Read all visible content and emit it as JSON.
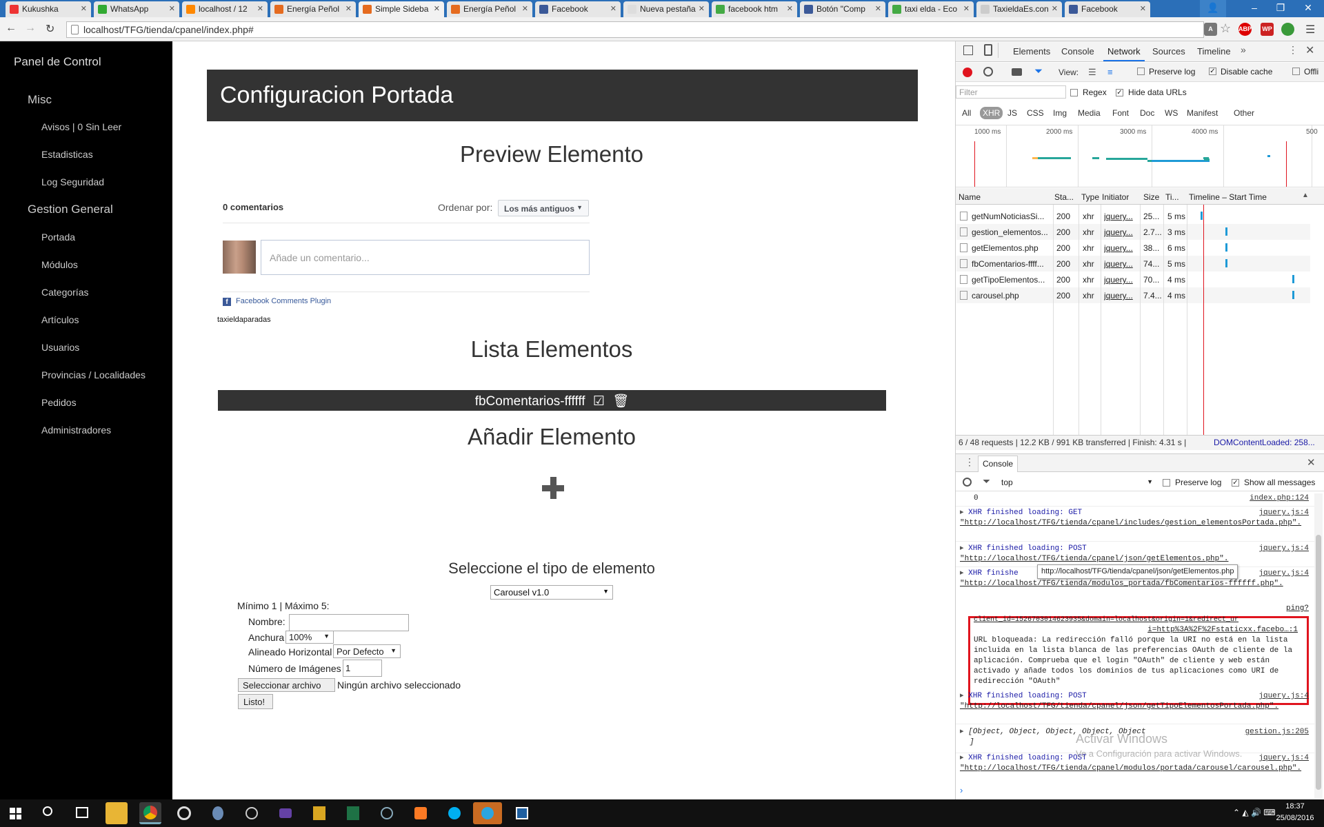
{
  "browser": {
    "tabs": [
      {
        "title": "Kukushka",
        "color": "#e33"
      },
      {
        "title": "WhatsApp",
        "color": "#3a3"
      },
      {
        "title": "localhost / 12",
        "color": "#f80"
      },
      {
        "title": "Energía Peñol",
        "color": "#e56b1f"
      },
      {
        "title": "Simple Sideba",
        "color": "#e56b1f"
      },
      {
        "title": "Energía Peñol",
        "color": "#e56b1f"
      },
      {
        "title": "Facebook",
        "color": "#3b5998"
      },
      {
        "title": "Nueva pestaña",
        "color": "#ddd"
      },
      {
        "title": "facebook htm",
        "color": "#4a4"
      },
      {
        "title": "Botón \"Comp",
        "color": "#3b5998"
      },
      {
        "title": "taxi elda - Eco",
        "color": "#4a4"
      },
      {
        "title": "TaxieldaEs.con",
        "color": "#ccc"
      },
      {
        "title": "Facebook",
        "color": "#3b5998"
      }
    ],
    "url": "localhost/TFG/tienda/cpanel/index.php#"
  },
  "sidebar": {
    "title": "Panel de Control",
    "sections": [
      {
        "label": "Misc",
        "items": [
          "Avisos | 0 Sin Leer",
          "Estadisticas",
          "Log Seguridad"
        ]
      },
      {
        "label": "Gestion General",
        "items": [
          "Portada",
          "Módulos",
          "Categorías",
          "Artículos",
          "Usuarios",
          "Provincias / Localidades",
          "Pedidos",
          "Administradores"
        ]
      }
    ]
  },
  "main": {
    "header": "Configuracion Portada",
    "preview_title": "Preview Elemento",
    "comments_count": "0 comentarios",
    "order_label": "Ordenar por:",
    "order_value": "Los más antiguos",
    "comment_placeholder": "Añade un comentario...",
    "plugin_label": "Facebook Comments Plugin",
    "page_name": "taxieldaparadas",
    "list_title": "Lista Elementos",
    "list_item": "fbComentarios-ffffff",
    "add_title": "Añadir Elemento",
    "select_type_title": "Seleccione el tipo de elemento",
    "type_value": "Carousel v1.0",
    "form": {
      "limits": "Mínimo 1 | Máximo 5:",
      "name_label": "Nombre:",
      "width_label": "Anchura",
      "width_value": "100%",
      "align_label": "Alineado Horizontal",
      "align_value": "Por Defecto",
      "images_label": "Número de Imágenes",
      "images_value": "1",
      "file_button": "Seleccionar archivo",
      "file_status": "Ningún archivo seleccionado",
      "submit": "Listo!"
    }
  },
  "devtools": {
    "tabs": [
      "Elements",
      "Console",
      "Network",
      "Sources",
      "Timeline"
    ],
    "toolbar": {
      "view": "View:",
      "preserve_log": "Preserve log",
      "disable_cache": "Disable cache",
      "offline": "Offli"
    },
    "filter_placeholder": "Filter",
    "regex": "Regex",
    "hide_data_urls": "Hide data URLs",
    "types": [
      "All",
      "XHR",
      "JS",
      "CSS",
      "Img",
      "Media",
      "Font",
      "Doc",
      "WS",
      "Manifest",
      "Other"
    ],
    "overview_ticks": [
      "1000 ms",
      "2000 ms",
      "3000 ms",
      "4000 ms",
      "500"
    ],
    "columns": [
      "Name",
      "Sta...",
      "Type",
      "Initiator",
      "Size",
      "Ti...",
      "Timeline – Start Time"
    ],
    "requests": [
      {
        "name": "getNumNoticiasSi...",
        "status": "200",
        "type": "xhr",
        "initiator": "jquery...",
        "size": "25...",
        "time": "5 ms",
        "bar": 0.09
      },
      {
        "name": "gestion_elementos...",
        "status": "200",
        "type": "xhr",
        "initiator": "jquery...",
        "size": "2.7...",
        "time": "3 ms",
        "bar": 0.33
      },
      {
        "name": "getElementos.php",
        "status": "200",
        "type": "xhr",
        "initiator": "jquery...",
        "size": "38...",
        "time": "6 ms",
        "bar": 0.33
      },
      {
        "name": "fbComentarios-ffff...",
        "status": "200",
        "type": "xhr",
        "initiator": "jquery...",
        "size": "74...",
        "time": "5 ms",
        "bar": 0.33
      },
      {
        "name": "getTipoElementos...",
        "status": "200",
        "type": "xhr",
        "initiator": "jquery...",
        "size": "70...",
        "time": "4 ms",
        "bar": 0.98
      },
      {
        "name": "carousel.php",
        "status": "200",
        "type": "xhr",
        "initiator": "jquery...",
        "size": "7.4...",
        "time": "4 ms",
        "bar": 0.98
      }
    ],
    "summary": "6 / 48 requests  |  12.2 KB / 991 KB transferred  |  Finish: 4.31 s  |",
    "dom_loaded": "DOMContentLoaded: 258...",
    "drawer_tab": "Console",
    "context": "top",
    "show_all": "Show all messages",
    "console": {
      "zero": "0",
      "zero_src": "index.php:124",
      "x1_head": "XHR finished loading: GET",
      "x1_src": "jquery.js:4",
      "x1_url": "\"http://localhost/TFG/tienda/cpanel/includes/gestion_elementosPortada.php\".",
      "x2_head": "XHR finished loading: POST",
      "x2_src": "jquery.js:4",
      "x2_url": "\"http://localhost/TFG/tienda/cpanel/json/getElementos.php\".",
      "x3_head": "XHR finishe",
      "x3_src": "jquery.js:4",
      "tooltip": "http://localhost/TFG/tienda/cpanel/json/getElementos.php",
      "x3_url": "\"http://localhost/TFG/tienda/modulos_portada/fbComentarios-ffffff.php\".",
      "ping": "ping?",
      "ping_line2": "client_id=1526703014623935&domain=localhost&origin=1&redirect_ur",
      "ping_line3": "i=http%3A%2F%2Fstaticxx.facebo…:1",
      "error": "URL bloqueada: La redirección falló porque la URI no está en la lista incluida en la lista blanca de las preferencias OAuth de cliente de la aplicación. Comprueba que el login \"OAuth\" de cliente y web están activado y añade todos los dominios de tus aplicaciones como URI de redirección \"OAuth\"",
      "x4_head": "XHR finished loading: POST",
      "x4_src": "jquery.js:4",
      "x4_url": "\"http://localhost/TFG/tienda/cpanel/json/getTipoElementosPortada.php\".",
      "obj": "[Object, Object, Object, Object, Object",
      "obj_end": "]",
      "obj_src": "gestion.js:205",
      "x5_head": "XHR finished loading: POST",
      "x5_src": "jquery.js:4",
      "x5_url": "\"http://localhost/TFG/tienda/cpanel/modulos/portada/carousel/carousel.php\"."
    },
    "watermark_1": "Activar Windows",
    "watermark_2": "Ve a Configuración para activar Windows."
  },
  "taskbar": {
    "time": "18:37",
    "date": "25/08/2016"
  },
  "colors": {
    "sidebar_bg": "#000000",
    "header_bg": "#333333",
    "error_border": "#e0141e",
    "record": "#e0141e",
    "accent": "#1a73e8"
  }
}
